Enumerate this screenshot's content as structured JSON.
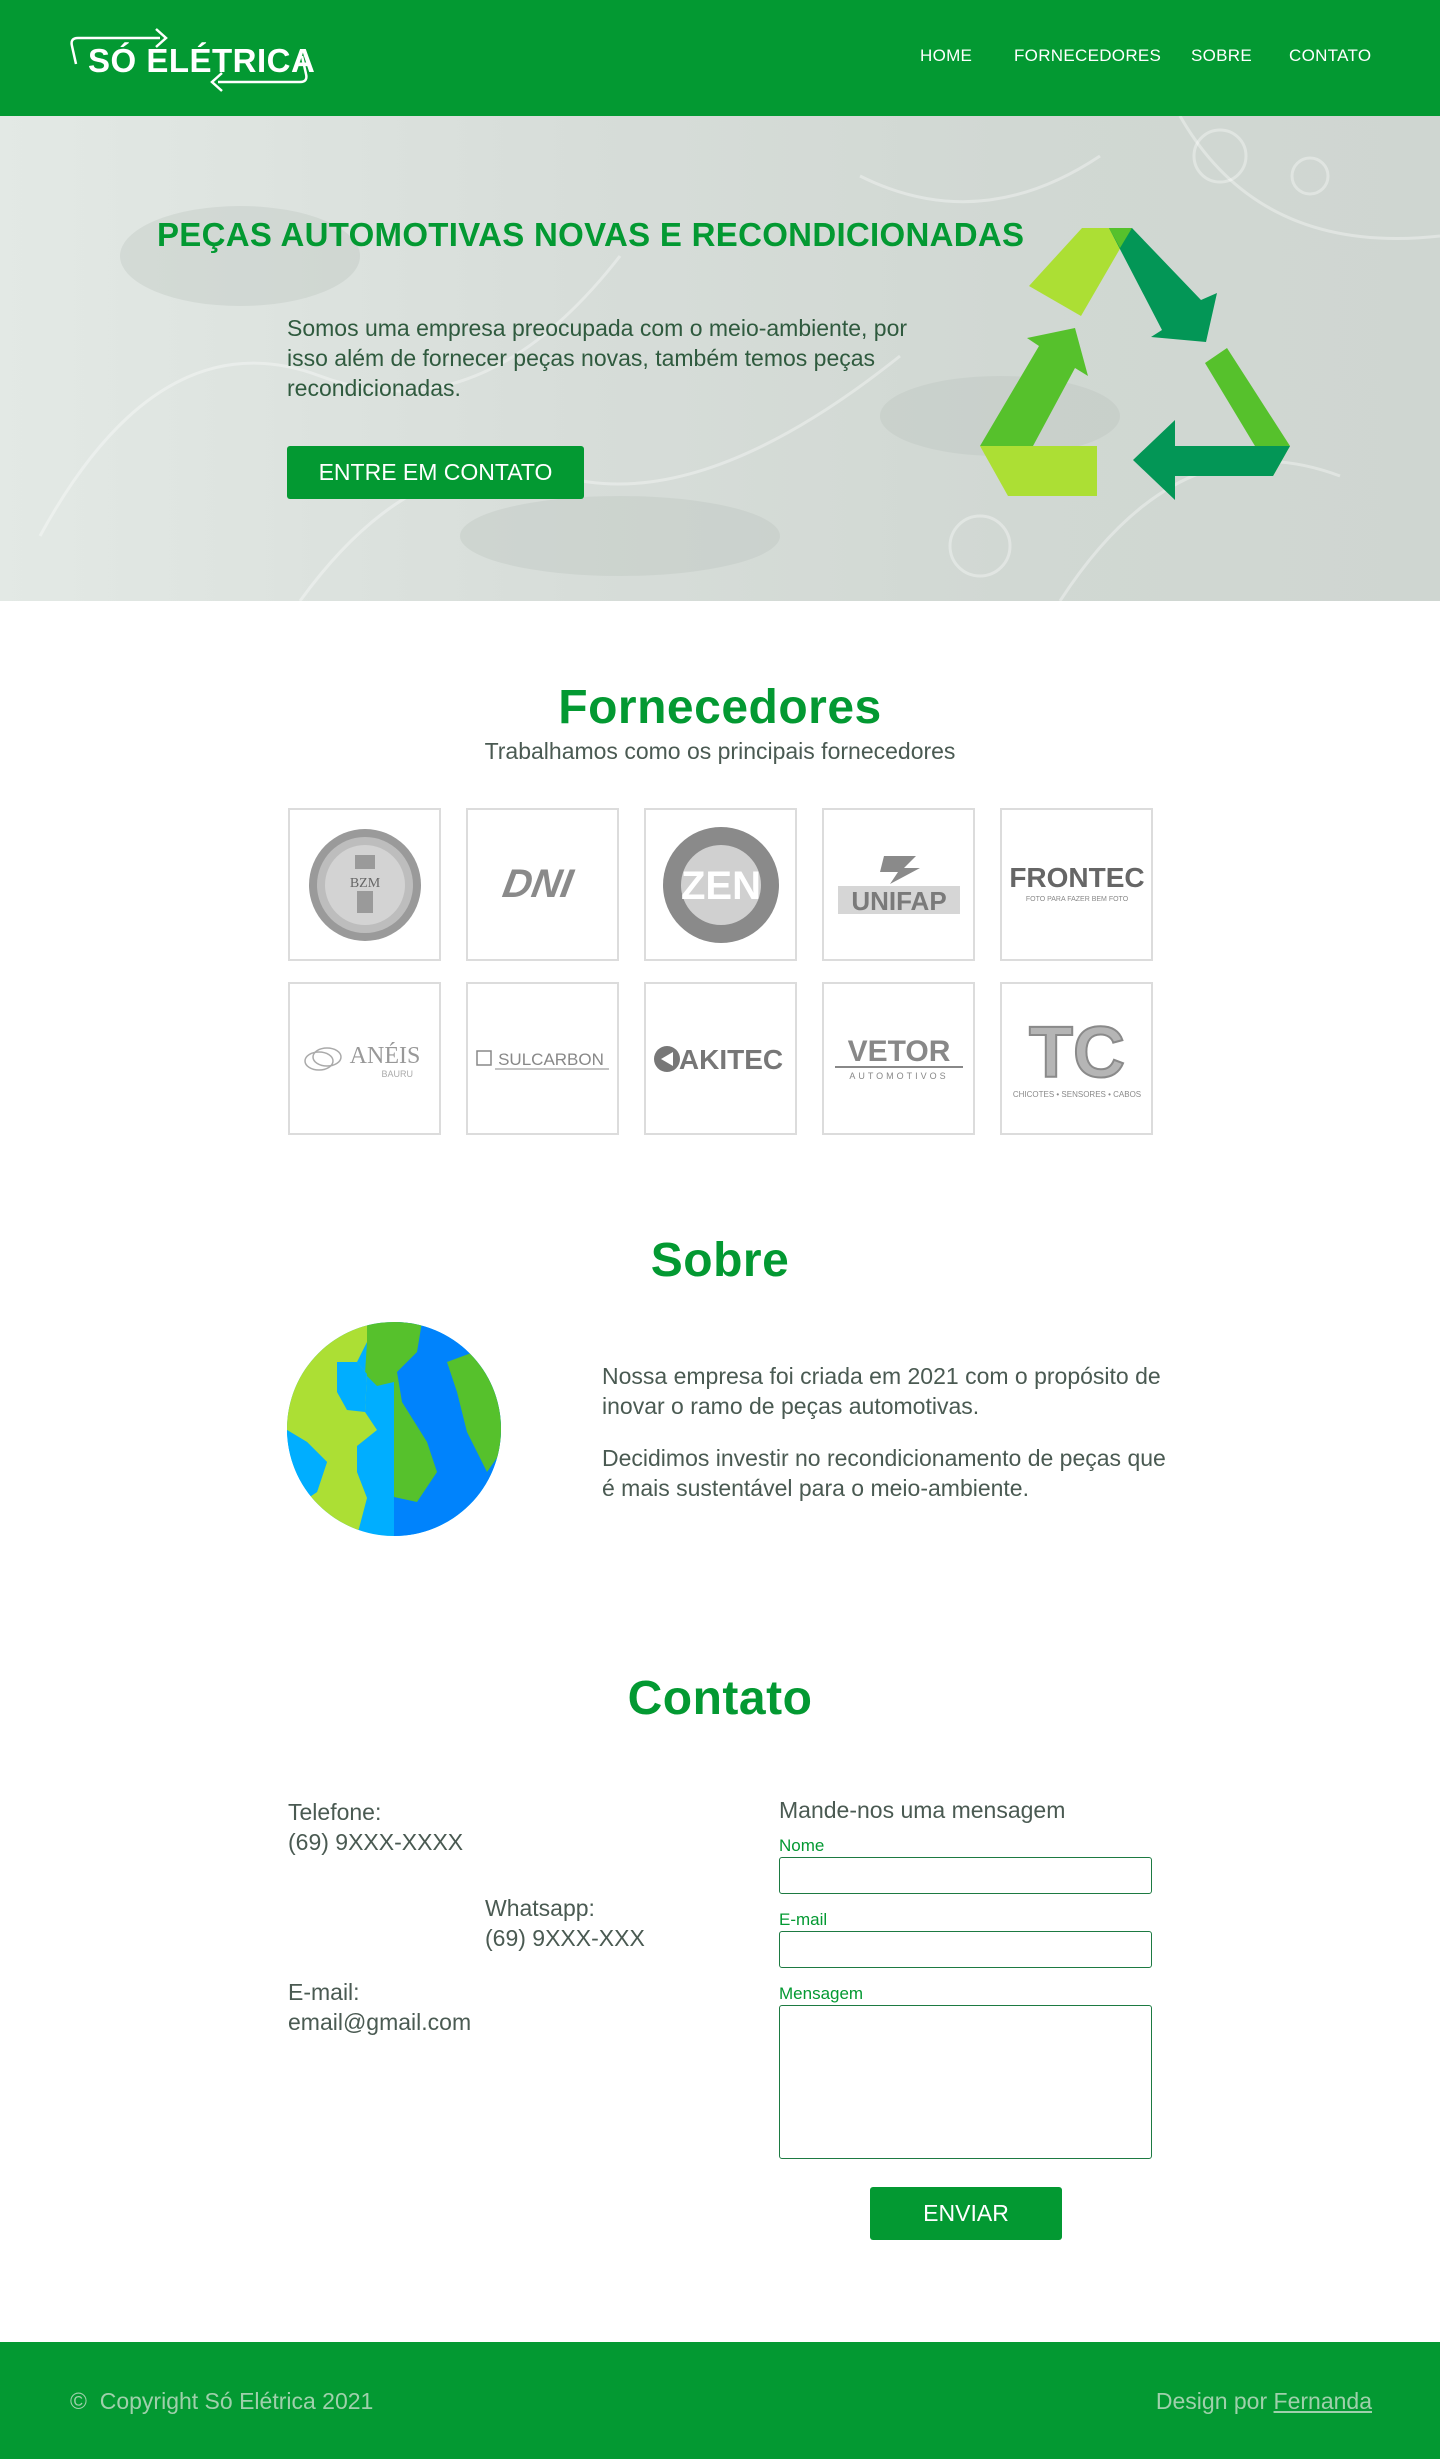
{
  "header": {
    "logo_text": "SÓ ELÉTRICA",
    "nav": [
      "HOME",
      "FORNECEDORES",
      "SOBRE",
      "CONTATO"
    ]
  },
  "hero": {
    "title": "PEÇAS AUTOMOTIVAS NOVAS E RECONDICIONADAS",
    "text": "Somos uma empresa preocupada com o meio-ambiente, por isso além de fornecer peças novas, também temos peças recondicionadas.",
    "button": "ENTRE EM CONTATO"
  },
  "suppliers": {
    "title": "Fornecedores",
    "subtitle": "Trabalhamos como os principais fornecedores",
    "logos": [
      "BZM",
      "DNI",
      "ZEN",
      "UNIFAP",
      "FRONTEC",
      "ANÉIS",
      "SULCARBON",
      "AKITEC",
      "VETOR",
      "TC"
    ],
    "frontec_tagline": "FOTO PARA FAZER BEM FOTO",
    "aneis_sub": "BAURU",
    "vetor_sub": "AUTOMOTIVOS",
    "tc_sub": "CHICOTES • SENSORES • CABOS"
  },
  "about": {
    "title": "Sobre",
    "p1": "Nossa empresa foi criada em 2021 com o propósito de inovar o ramo de peças automotivas.",
    "p2": "Decidimos investir no recondicionamento de peças que é mais sustentável para o meio-ambiente."
  },
  "contact": {
    "title": "Contato",
    "phone_label": "Telefone:",
    "phone_value": "(69) 9XXX-XXXX",
    "whatsapp_label": "Whatsapp:",
    "whatsapp_value": "(69) 9XXX-XXX",
    "email_label": "E-mail:",
    "email_value": "email@gmail.com",
    "form_title": "Mande-nos uma mensagem",
    "name_label": "Nome",
    "email_field_label": "E-mail",
    "message_label": "Mensagem",
    "send_button": "ENVIAR"
  },
  "footer": {
    "copyright_symbol": "©",
    "copyright": "Copyright Só Elétrica 2021",
    "design_prefix": "Design por",
    "designer": "Fernanda"
  },
  "colors": {
    "primary_green": "#039932",
    "text_gray": "#4a5a52",
    "recycle_light": "#acdf34",
    "recycle_mid": "#56c12c",
    "recycle_dark": "#039656",
    "globe_blue": "#0083fc",
    "globe_cyan": "#00aeff"
  }
}
